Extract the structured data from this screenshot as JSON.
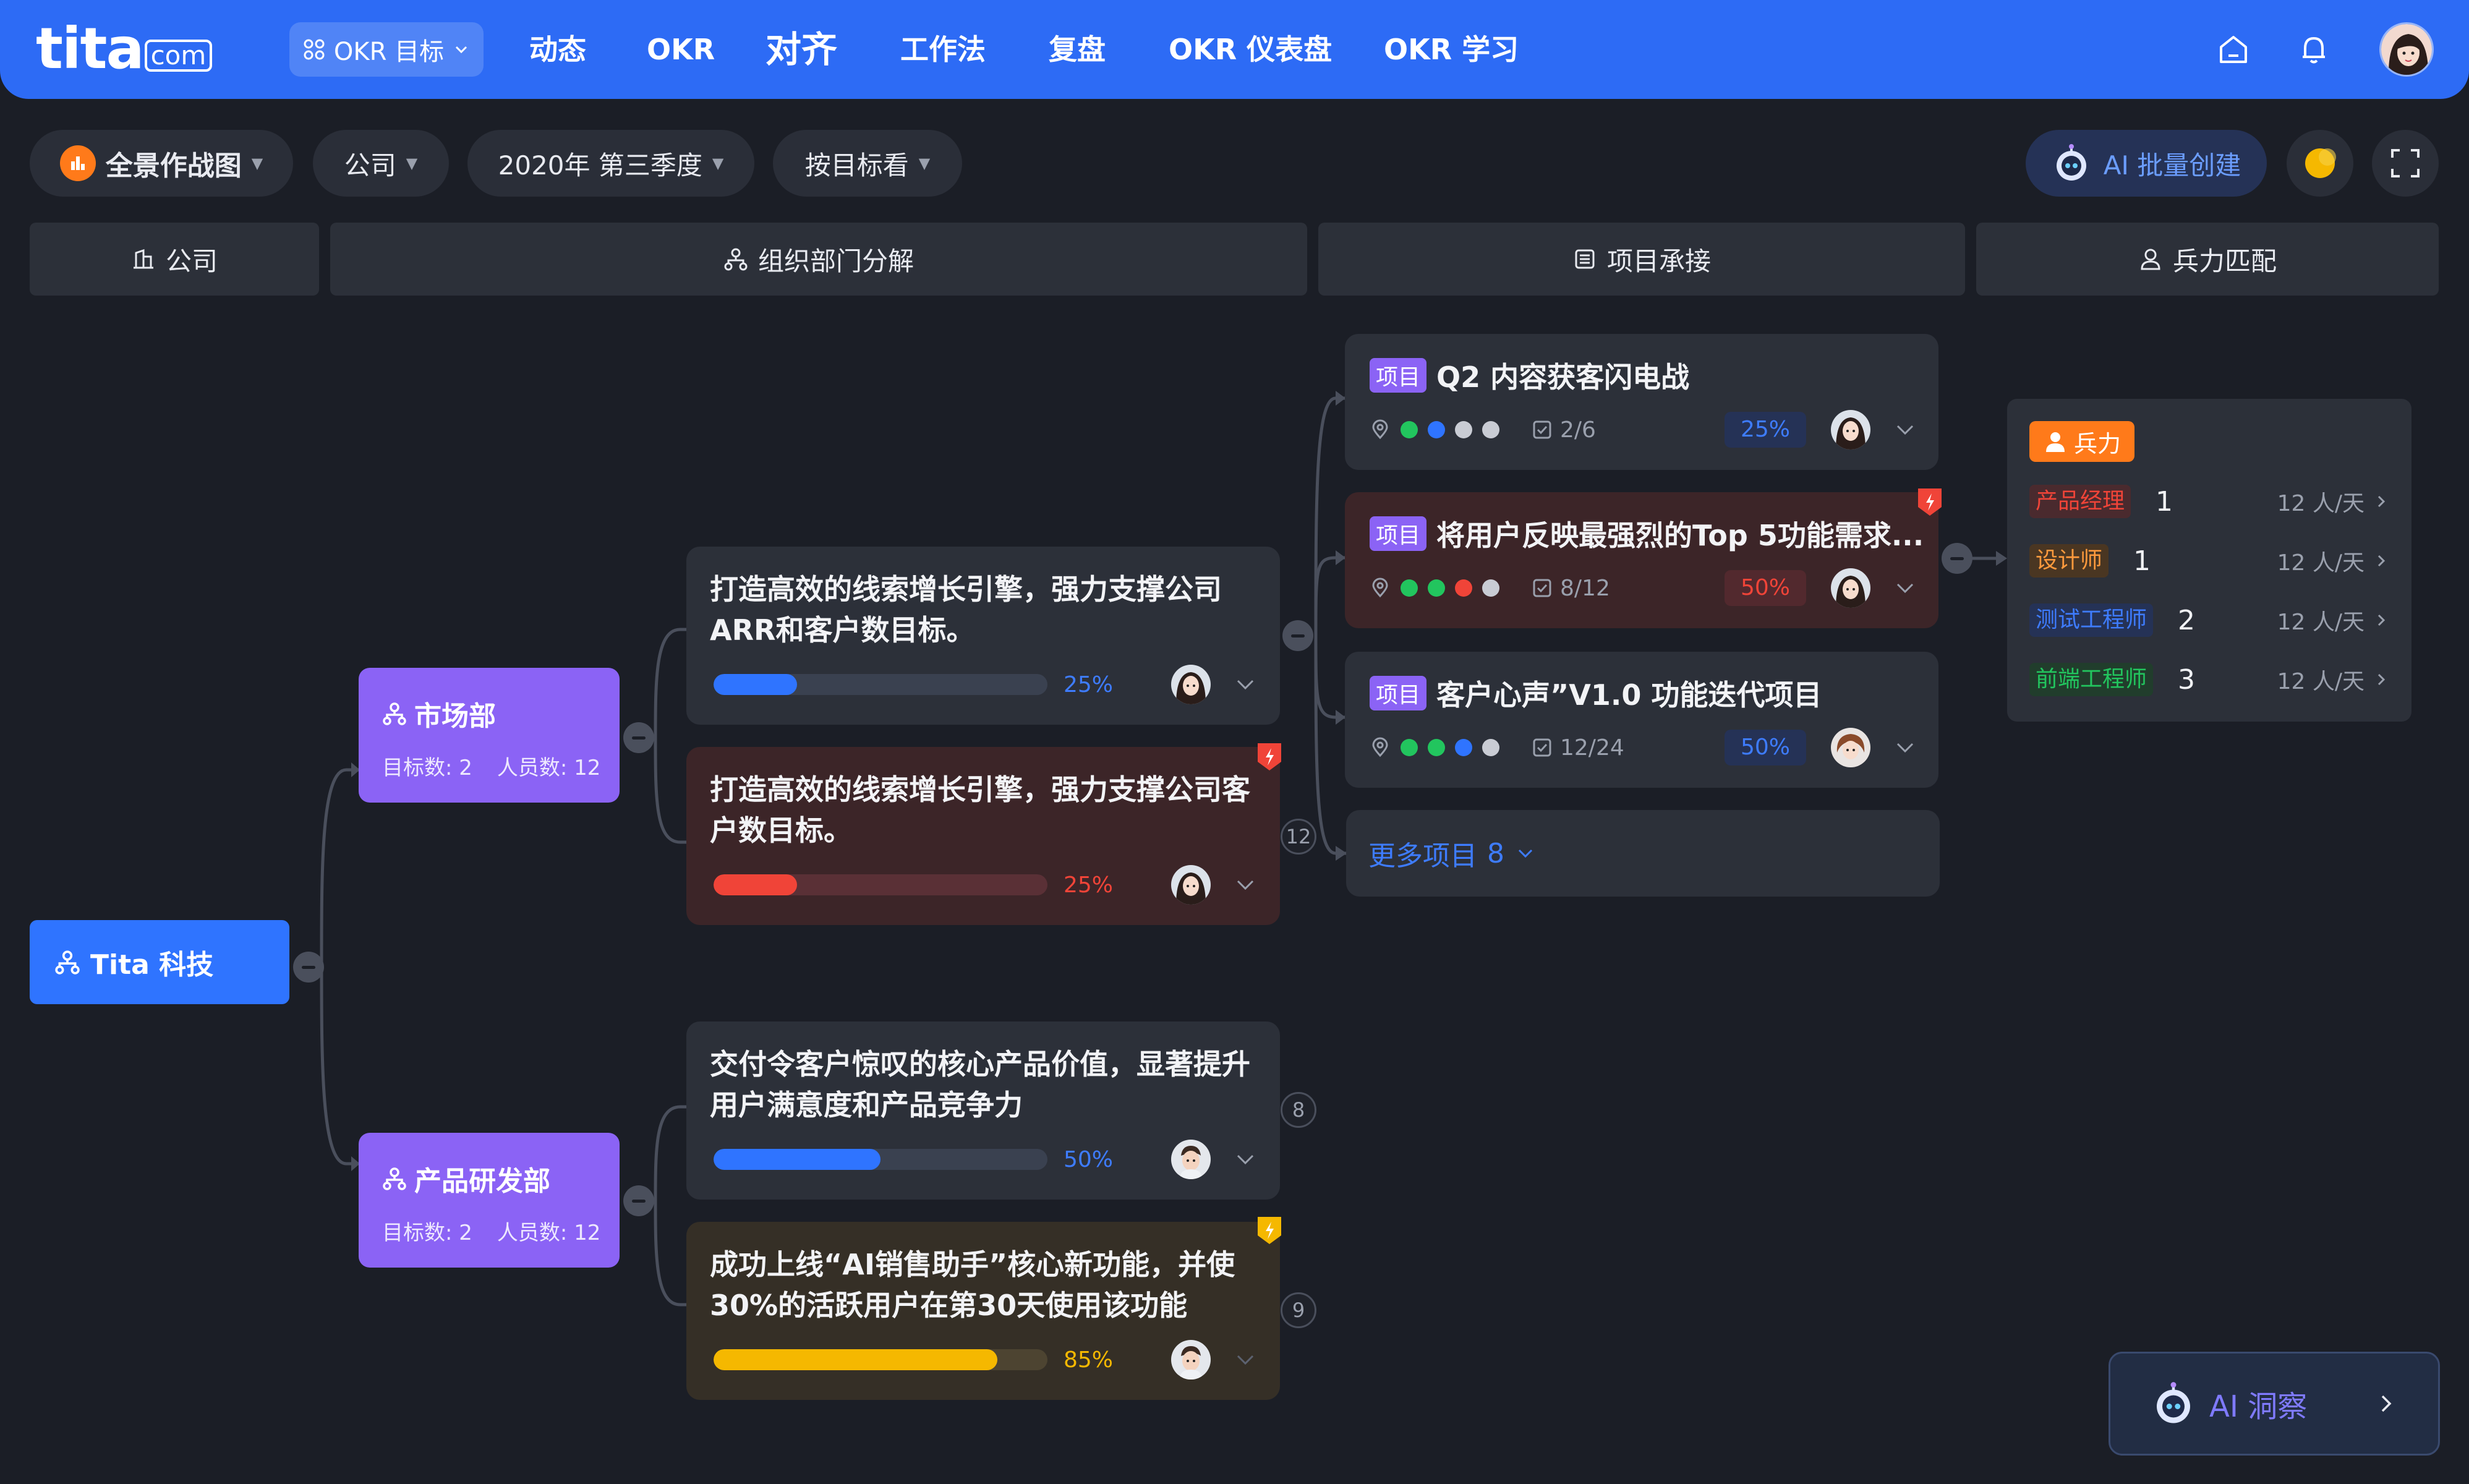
{
  "app": {
    "logo_text": "tita",
    "logo_suffix": "com"
  },
  "nav": {
    "okr_menu": "OKR 目标",
    "items": [
      "动态",
      "OKR",
      "对齐",
      "工作法",
      "复盘",
      "OKR 仪表盘",
      "OKR 学习"
    ],
    "active_item": "对齐"
  },
  "toolbar": {
    "view": "全景作战图",
    "scope": "公司",
    "period": "2020年 第三季度",
    "mode": "按目标看",
    "ai_create": "AI 批量创建"
  },
  "columns": [
    "公司",
    "组织部门分解",
    "项目承接",
    "兵力匹配"
  ],
  "root": {
    "label": "Tita 科技"
  },
  "departments": [
    {
      "name": "市场部",
      "goals": "目标数: 2",
      "people": "人员数: 12"
    },
    {
      "name": "产品研发部",
      "goals": "目标数: 2",
      "people": "人员数: 12"
    }
  ],
  "objectives": [
    {
      "title": "打造高效的线索增长引擎，强力支撑公司ARR和客户数目标。",
      "progress": 25,
      "progress_label": "25%",
      "status": "normal",
      "color": "#2f74ff"
    },
    {
      "title": "打造高效的线索增长引擎，强力支撑公司客户数目标。",
      "progress": 25,
      "progress_label": "25%",
      "status": "risk",
      "color": "#f04438"
    },
    {
      "title": "交付令客户惊叹的核心产品价值，显著提升用户满意度和产品竞争力",
      "progress": 50,
      "progress_label": "50%",
      "status": "normal",
      "color": "#2f74ff"
    },
    {
      "title": "成功上线“AI销售助手”核心新功能，并使30%的活跃用户在第30天使用该功能",
      "progress": 85,
      "progress_label": "85%",
      "status": "warning",
      "color": "#f5b800"
    }
  ],
  "badges": {
    "market_projects": "12",
    "obj3_projects": "8",
    "obj4_projects": "9"
  },
  "projects": [
    {
      "tag": "项目",
      "title": "Q2 内容获客闪电战",
      "tasks": "2/6",
      "progress_label": "25%",
      "dots": [
        "#22c55e",
        "#2f74ff",
        "#c9ccd4",
        "#c9ccd4"
      ],
      "pill_color": "#3e7cff",
      "pill_bg": "#253256"
    },
    {
      "tag": "项目",
      "title": "将用户反映最强烈的Top 5功能需求...",
      "tasks": "8/12",
      "progress_label": "50%",
      "dots": [
        "#22c55e",
        "#22c55e",
        "#f04438",
        "#c9ccd4"
      ],
      "pill_color": "#f04438",
      "pill_bg": "#52292e"
    },
    {
      "tag": "项目",
      "title": "客户心声”V1.0 功能迭代项目",
      "tasks": "12/24",
      "progress_label": "50%",
      "dots": [
        "#22c55e",
        "#22c55e",
        "#2f74ff",
        "#c9ccd4"
      ],
      "pill_color": "#3e7cff",
      "pill_bg": "#253256"
    }
  ],
  "more_projects": {
    "label": "更多项目",
    "count": "8"
  },
  "force": {
    "tag": "兵力",
    "rows": [
      {
        "role": "产品经理",
        "count": "1",
        "rate": "12 人/天",
        "color": "#f04438",
        "bg": "#4a2a2e"
      },
      {
        "role": "设计师",
        "count": "1",
        "rate": "12 人/天",
        "color": "#ff9a3d",
        "bg": "#4a3622"
      },
      {
        "role": "测试工程师",
        "count": "2",
        "rate": "12 人/天",
        "color": "#3e7cff",
        "bg": "#253256"
      },
      {
        "role": "前端工程师",
        "count": "3",
        "rate": "12 人/天",
        "color": "#22c55e",
        "bg": "#213d2c"
      }
    ]
  },
  "ai_insight": {
    "label": "AI 洞察"
  },
  "icons": [
    "home-icon",
    "bell-icon",
    "robot-icon",
    "moon-icon",
    "fullscreen-icon",
    "building-icon",
    "org-icon",
    "list-icon",
    "user-icon",
    "chevron-down-icon",
    "flag-icon",
    "location-icon",
    "checkbox-icon",
    "chevron-right-icon"
  ]
}
